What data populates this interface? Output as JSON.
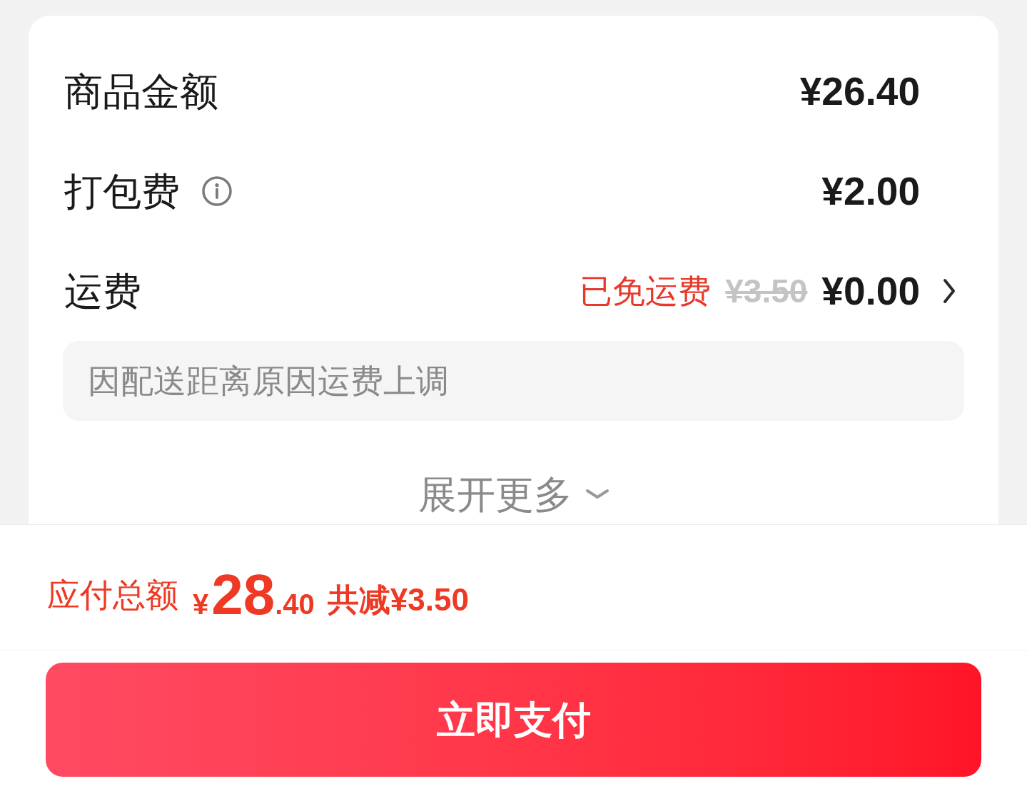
{
  "fee_rows": [
    {
      "kind": "plain",
      "label": "商品金额",
      "value": "¥26.40"
    },
    {
      "kind": "info",
      "label": "打包费",
      "value": "¥2.00"
    },
    {
      "kind": "shipping",
      "label": "运费",
      "badge": "已免运费",
      "original": "¥3.50",
      "value": "¥0.00"
    }
  ],
  "notice": "因配送距离原因运费上调",
  "expand": {
    "label": "展开更多",
    "expanded": false
  },
  "total": {
    "label": "应付总额",
    "currency": "¥",
    "integer": "28",
    "decimal": ".40",
    "saving": "共减¥3.50"
  },
  "pay_button": "立即支付"
}
